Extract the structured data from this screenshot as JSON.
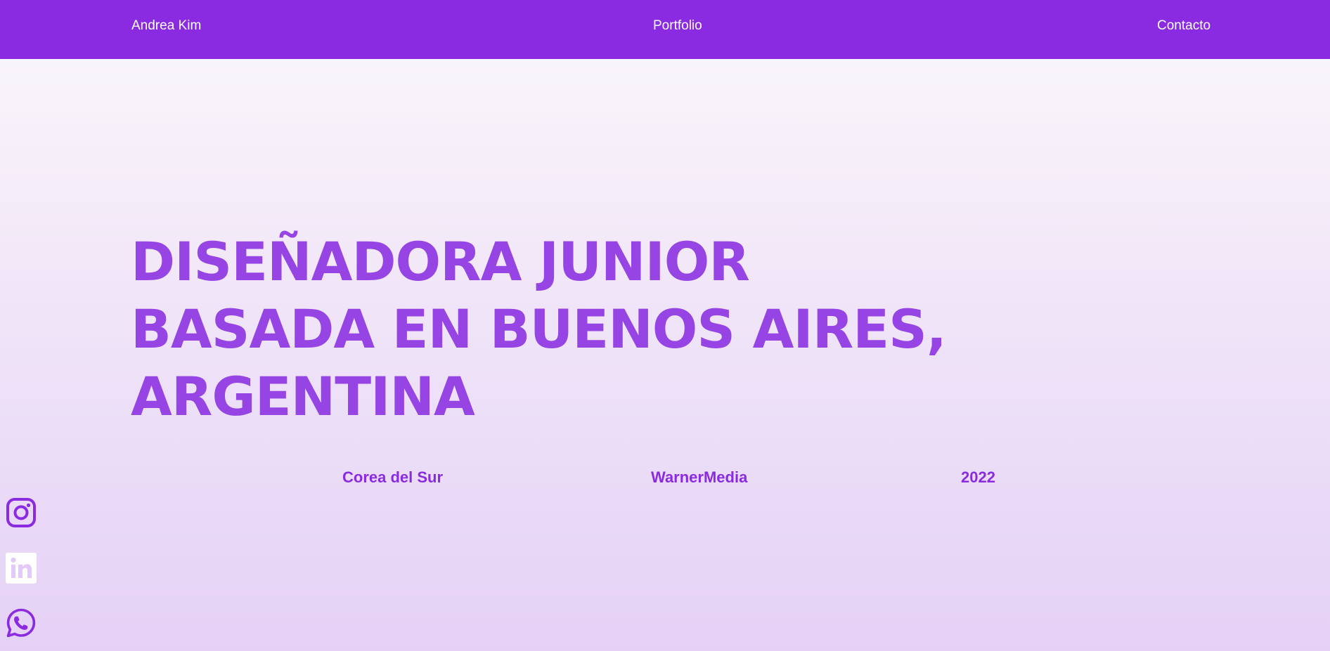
{
  "nav": {
    "brand": "Andrea Kim",
    "portfolio": "Portfolio",
    "contact": "Contacto"
  },
  "hero": {
    "lines": [
      "DISEÑADORA JUNIOR",
      "BASADA EN BUENOS AIRES,",
      "ARGENTINA"
    ]
  },
  "facts": {
    "location": "Corea del Sur",
    "company": "WarnerMedia",
    "year": "2022"
  },
  "social": [
    {
      "icon": "instagram-icon"
    },
    {
      "icon": "linkedin-icon"
    },
    {
      "icon": "whatsapp-icon"
    }
  ],
  "colors": {
    "accent": "#8a2be2",
    "headline": "#9644e4",
    "background_top": "#fbf9fd",
    "background_bottom": "#e5d1f6"
  }
}
